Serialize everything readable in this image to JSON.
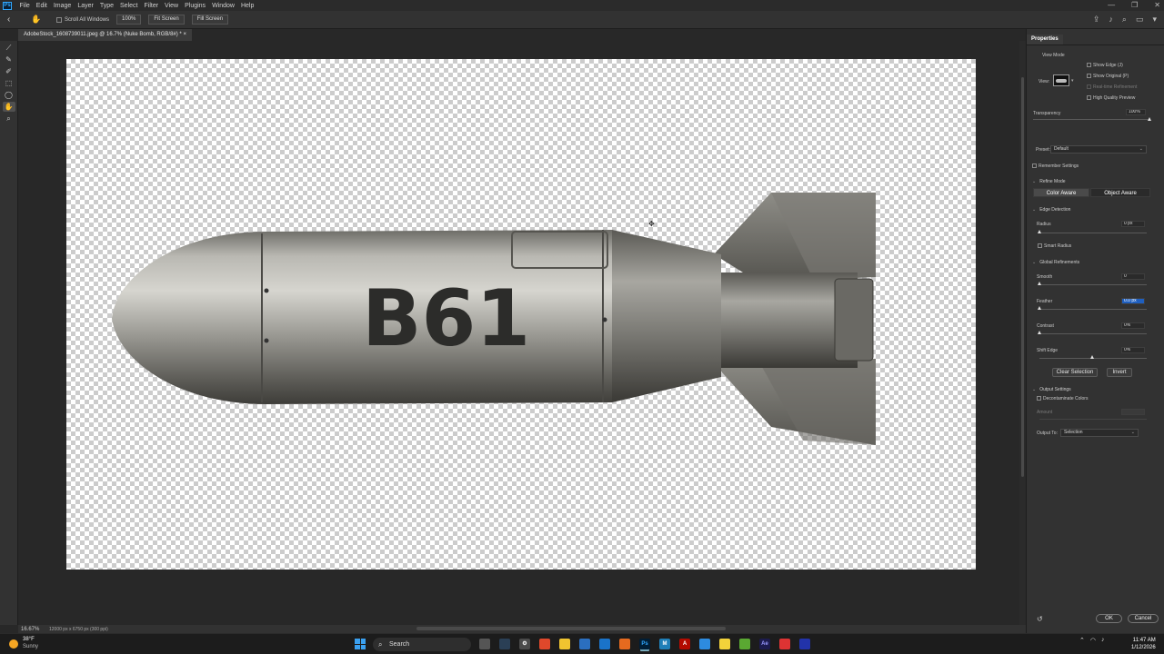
{
  "app": {
    "logo": "Ps"
  },
  "menu": [
    "File",
    "Edit",
    "Image",
    "Layer",
    "Type",
    "Select",
    "Filter",
    "View",
    "Plugins",
    "Window",
    "Help"
  ],
  "window_controls": [
    "—",
    "❐",
    "✕"
  ],
  "options_bar": {
    "scroll_all_windows": "Scroll All Windows",
    "zoom_100": "100%",
    "fit_screen": "Fit Screen",
    "fill_screen": "Fill Screen"
  },
  "document": {
    "tab_title": "AdobeStock_1608739011.jpeg @ 16.7% (Nuke Bomb, RGB/8#) *",
    "artwork_text": "B61"
  },
  "status_bar": {
    "zoom": "16.67%",
    "dimensions": "12000 px x 6750 px (300 ppi)"
  },
  "properties": {
    "panel_title": "Properties",
    "view_mode_title": "View Mode",
    "view_label": "View:",
    "show_edge": "Show Edge (J)",
    "show_original": "Show Original (P)",
    "realtime_refinement": "Real-time Refinement",
    "high_quality_preview": "High Quality Preview",
    "transparency_label": "Transparency",
    "transparency_value": "100%",
    "transparency_level": 1.0,
    "preset_label": "Preset:",
    "preset_value": "Default",
    "remember_settings": "Remember Settings",
    "refine_mode_title": "Refine Mode",
    "color_aware": "Color Aware",
    "object_aware": "Object Aware",
    "edge_detection_title": "Edge Detection",
    "radius_label": "Radius",
    "radius_value": "0 px",
    "smart_radius": "Smart Radius",
    "global_refinements_title": "Global Refinements",
    "smooth_label": "Smooth",
    "smooth_value": "0",
    "feather_label": "Feather",
    "feather_value": "0.0 px",
    "contrast_label": "Contrast",
    "contrast_value": "0%",
    "shift_edge_label": "Shift Edge",
    "shift_edge_value": "0%",
    "clear_selection": "Clear Selection",
    "invert": "Invert",
    "output_settings_title": "Output Settings",
    "decontaminate_colors": "Decontaminate Colors",
    "amount_label": "Amount",
    "output_to_label": "Output To:",
    "output_to_value": "Selection",
    "ok": "OK",
    "cancel": "Cancel"
  },
  "taskbar": {
    "temperature": "38°F",
    "condition": "Sunny",
    "search": "Search",
    "time": "11:47 AM",
    "date": "1/12/2026"
  }
}
